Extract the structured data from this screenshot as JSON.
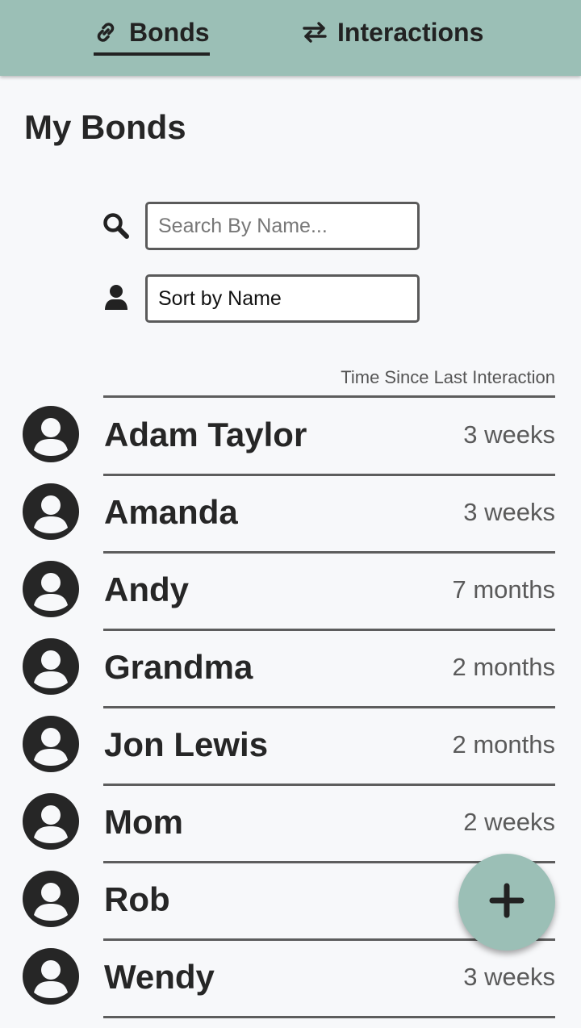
{
  "nav": {
    "tabs": [
      {
        "label": "Bonds",
        "icon": "link-icon",
        "active": true
      },
      {
        "label": "Interactions",
        "icon": "swap-arrows-icon",
        "active": false
      }
    ]
  },
  "page": {
    "title": "My Bonds"
  },
  "search": {
    "placeholder": "Search By Name...",
    "value": "",
    "icon": "search-icon"
  },
  "sort": {
    "selected": "Sort by Name",
    "icon": "person-icon"
  },
  "list": {
    "column_header": "Time Since Last Interaction",
    "items": [
      {
        "name": "Adam Taylor",
        "since": "3 weeks"
      },
      {
        "name": "Amanda",
        "since": "3 weeks"
      },
      {
        "name": "Andy",
        "since": "7 months"
      },
      {
        "name": "Grandma",
        "since": "2 months"
      },
      {
        "name": "Jon Lewis",
        "since": "2 months"
      },
      {
        "name": "Mom",
        "since": "2 weeks"
      },
      {
        "name": "Rob",
        "since": ""
      },
      {
        "name": "Wendy",
        "since": "3 weeks"
      }
    ]
  },
  "fab": {
    "icon": "plus-icon"
  },
  "colors": {
    "accent": "#9bbfb6",
    "text": "#262626",
    "muted": "#5a5a5a",
    "background": "#f7f8fa"
  }
}
